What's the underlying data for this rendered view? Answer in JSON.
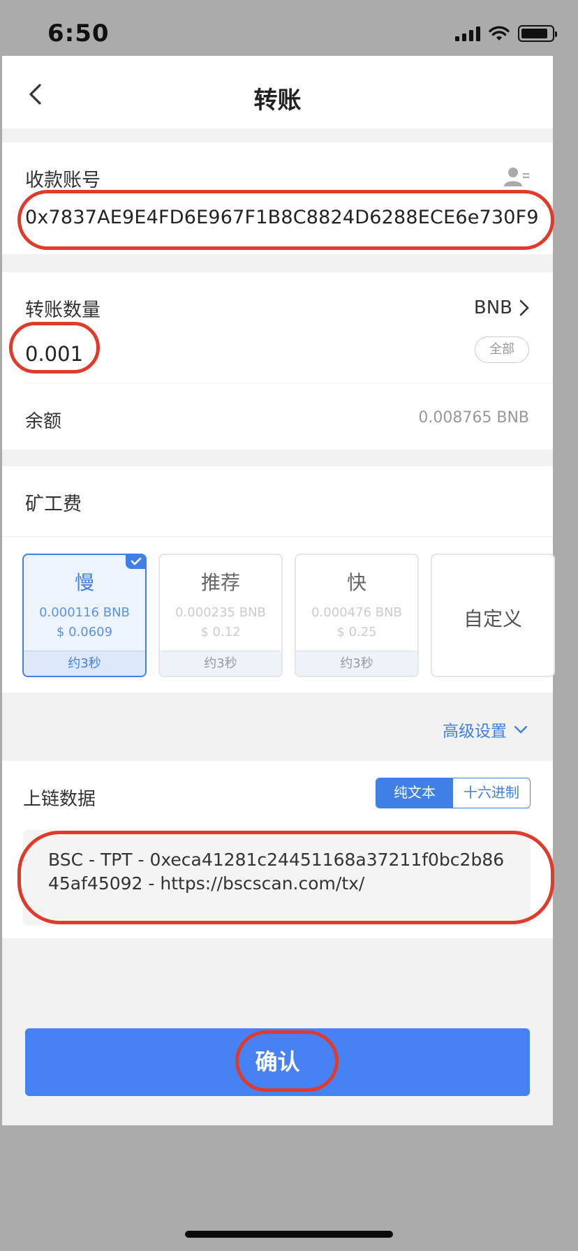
{
  "status_bar": {
    "time": "6:50"
  },
  "nav": {
    "title": "转账"
  },
  "recipient": {
    "label": "收款账号",
    "address": "0x7837AE9E4FD6E967F1B8C8824D6288ECE6e730F9"
  },
  "amount": {
    "label": "转账数量",
    "token": "BNB",
    "value": "0.001",
    "all_label": "全部",
    "balance_label": "余额",
    "balance_value": "0.008765 BNB"
  },
  "fee": {
    "title": "矿工费",
    "options": [
      {
        "name": "慢",
        "bnb": "0.000116 BNB",
        "usd": "$ 0.0609",
        "time": "约3秒",
        "selected": true
      },
      {
        "name": "推荐",
        "bnb": "0.000235 BNB",
        "usd": "$ 0.12",
        "time": "约3秒",
        "selected": false
      },
      {
        "name": "快",
        "bnb": "0.000476 BNB",
        "usd": "$ 0.25",
        "time": "约3秒",
        "selected": false
      }
    ],
    "custom_label": "自定义",
    "advanced_label": "高级设置"
  },
  "chain_data": {
    "label": "上链数据",
    "modes": [
      "纯文本",
      "十六进制"
    ],
    "active_mode": "纯文本",
    "text": "BSC - TPT - 0xeca41281c24451168a37211f0bc2b8645af45092 - https://bscscan.com/tx/"
  },
  "confirm": {
    "label": "确认"
  },
  "colors": {
    "accent": "#3f7fe6",
    "button": "#4682f4",
    "annotation": "#e03a2a",
    "background": "#ababab"
  }
}
